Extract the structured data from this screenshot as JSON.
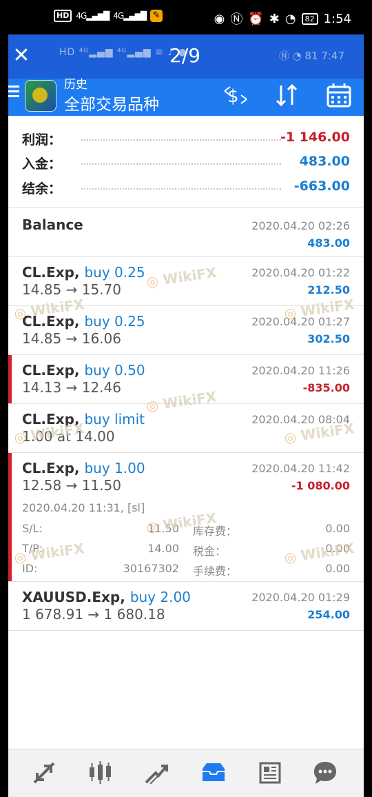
{
  "status_bar": {
    "left_badge": "HD",
    "network_1": "4G",
    "network_2": "4G",
    "battery": "82",
    "time": "1:54"
  },
  "viewer": {
    "page_counter": "2/9",
    "inner_battery": "81",
    "inner_time": "7:47"
  },
  "toolbar": {
    "subtitle": "历史",
    "title": "全部交易品种"
  },
  "summary": {
    "profit_label": "利润：",
    "profit_value": "-1 146.00",
    "deposit_label": "入金：",
    "deposit_value": "483.00",
    "balance_label": "结余：",
    "balance_value": "-663.00"
  },
  "entries": [
    {
      "symbol": "Balance",
      "type": "",
      "prices": "",
      "time": "2020.04.20 02:26",
      "profit": "483.00",
      "profit_color": "#1a7fd0"
    },
    {
      "symbol": "CL.Exp,",
      "type": "buy 0.25",
      "prices": "14.85 → 15.70",
      "time": "2020.04.20 01:22",
      "profit": "212.50",
      "profit_color": "#1a7fd0"
    },
    {
      "symbol": "CL.Exp,",
      "type": "buy 0.25",
      "prices": "14.85 → 16.06",
      "time": "2020.04.20 01:27",
      "profit": "302.50",
      "profit_color": "#1a7fd0"
    },
    {
      "symbol": "CL.Exp,",
      "type": "buy 0.50",
      "prices": "14.13 → 12.46",
      "time": "2020.04.20 11:26",
      "profit": "-835.00",
      "profit_color": "#c8202a"
    },
    {
      "symbol": "CL.Exp,",
      "type": "buy limit",
      "prices": "1.00 at 14.00",
      "time": "2020.04.20 08:04",
      "profit": "",
      "profit_color": "#1a7fd0"
    },
    {
      "symbol": "CL.Exp,",
      "type": "buy 1.00",
      "prices": "12.58 → 11.50",
      "time": "2020.04.20 11:42",
      "profit": "-1 080.00",
      "profit_color": "#c8202a"
    },
    {
      "symbol": "XAUUSD.Exp,",
      "type": "buy 2.00",
      "prices": "1 678.91 → 1 680.18",
      "time": "2020.04.20 01:29",
      "profit": "254.00",
      "profit_color": "#1a7fd0"
    }
  ],
  "expanded_detail": {
    "open_line": "2020.04.20 11:31, [sl]",
    "sl_label": "S/L:",
    "sl_value": "11.50",
    "tp_label": "T/P:",
    "tp_value": "14.00",
    "id_label": "ID:",
    "id_value": "30167302",
    "swap_label": "库存费：",
    "swap_value": "0.00",
    "tax_label": "税金：",
    "tax_value": "0.00",
    "fee_label": "手续费：",
    "fee_value": "0.00"
  },
  "watermark_text": "WikiFX",
  "bottom_nav": [
    "quotes-icon",
    "chart-icon",
    "trade-icon",
    "history-icon",
    "news-icon",
    "chat-icon"
  ],
  "accent_color": "#1f7cf0"
}
